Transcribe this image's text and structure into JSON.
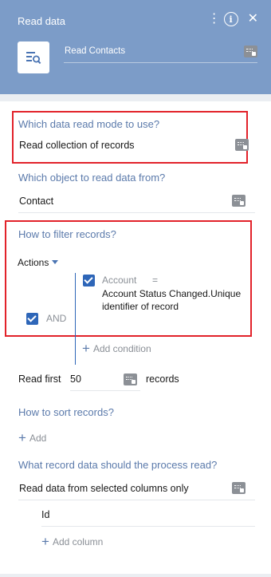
{
  "header": {
    "title": "Read data",
    "element_name": "Read Contacts",
    "background_color": "#7c9cc8",
    "icons": [
      "more-options-icon",
      "info-icon",
      "close-icon",
      "read-data-icon",
      "parameter-icon"
    ]
  },
  "read_mode": {
    "question": "Which data read mode to use?",
    "value": "Read collection of records"
  },
  "object": {
    "question": "Which object to read data from?",
    "value": "Contact"
  },
  "filter": {
    "question": "How to filter records?",
    "actions_label": "Actions",
    "group_operator": "AND",
    "condition": {
      "checked": true,
      "column": "Account",
      "operator": "=",
      "value": "Account Status Changed.Unique identifier of record"
    },
    "add_condition_label": "Add condition"
  },
  "read_first": {
    "label": "Read first",
    "value": "50",
    "unit": "records"
  },
  "sort": {
    "question": "How to sort records?",
    "add_label": "Add"
  },
  "columns": {
    "question": "What record data should the process read?",
    "mode_value": "Read data from selected columns only",
    "items": [
      "Id"
    ],
    "add_column_label": "Add column"
  },
  "colors": {
    "question_text": "#5b7aab",
    "checkbox": "#2e66b8",
    "highlight_border": "#e2222a"
  }
}
